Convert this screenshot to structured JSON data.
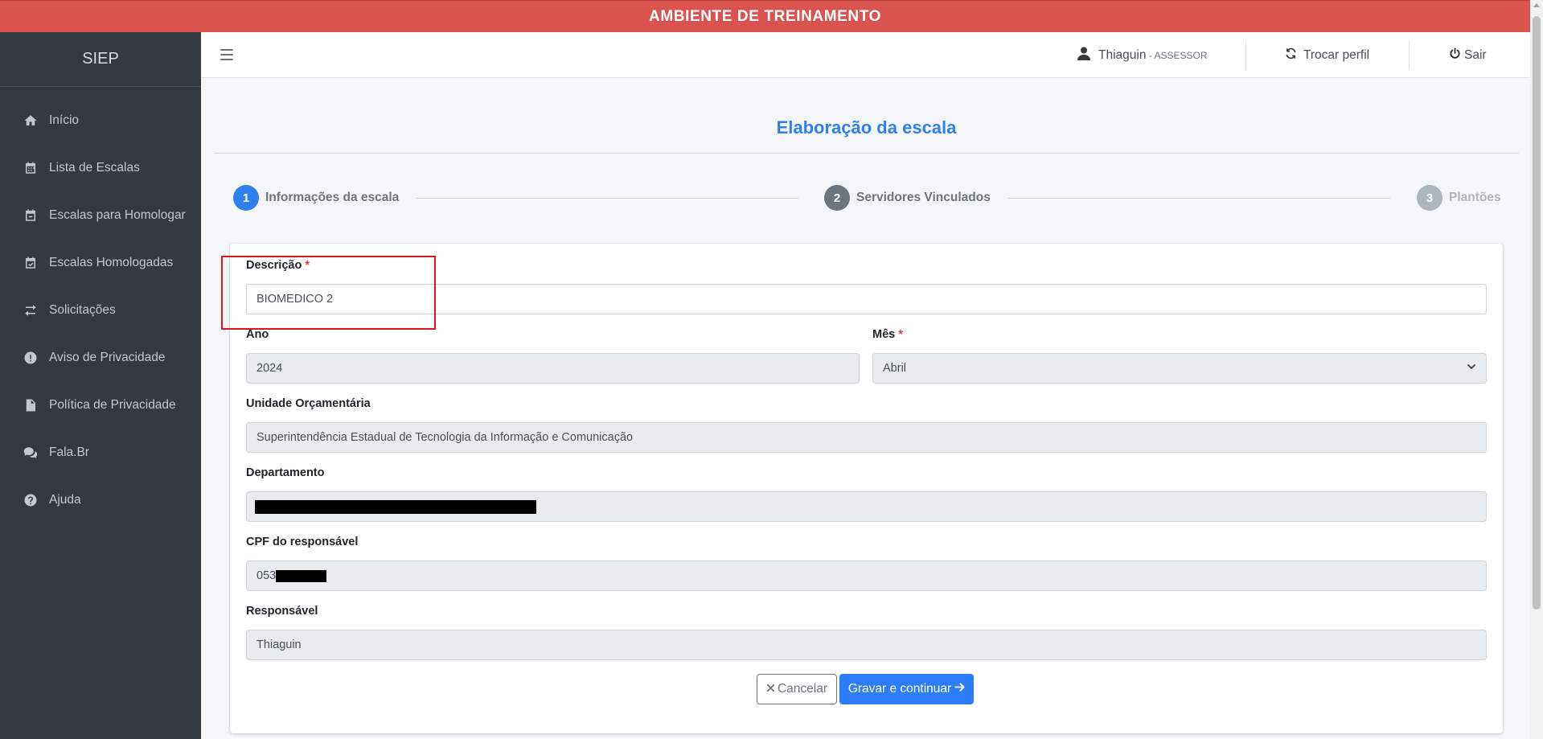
{
  "banner": {
    "text": "AMBIENTE DE TREINAMENTO"
  },
  "brand": "SIEP",
  "sidebar": {
    "items": [
      {
        "label": "Início",
        "icon": "home-icon"
      },
      {
        "label": "Lista de Escalas",
        "icon": "calendar-icon"
      },
      {
        "label": "Escalas para Homologar",
        "icon": "calendar-minus-icon"
      },
      {
        "label": "Escalas Homologadas",
        "icon": "calendar-check-icon"
      },
      {
        "label": "Solicitações",
        "icon": "exchange-icon"
      },
      {
        "label": "Aviso de Privacidade",
        "icon": "exclamation-circle-icon"
      },
      {
        "label": "Política de Privacidade",
        "icon": "file-icon"
      },
      {
        "label": "Fala.Br",
        "icon": "comments-icon"
      },
      {
        "label": "Ajuda",
        "icon": "question-circle-icon"
      }
    ]
  },
  "navbar": {
    "user_name": "Thiaguin",
    "user_sep": " - ",
    "user_role": "ASSESSOR",
    "switch_profile": "Trocar perfil",
    "logout": "Sair"
  },
  "page": {
    "title": "Elaboração da escala"
  },
  "stepper": {
    "steps": [
      {
        "number": "1",
        "label": "Informações da escala",
        "state": "active"
      },
      {
        "number": "2",
        "label": "Servidores Vinculados",
        "state": "pending"
      },
      {
        "number": "3",
        "label": "Plantões",
        "state": "disabled"
      }
    ]
  },
  "form": {
    "descricao": {
      "label": "Descrição",
      "required_mark": "*",
      "value": "BIOMEDICO 2"
    },
    "ano": {
      "label": "Ano",
      "value": "2024"
    },
    "mes": {
      "label": "Mês",
      "required_mark": "*",
      "value": "Abril"
    },
    "unidade": {
      "label": "Unidade Orçamentária",
      "value": "Superintendência Estadual de Tecnologia da Informação e Comunicação"
    },
    "departamento": {
      "label": "Departamento",
      "value": ""
    },
    "cpf": {
      "label": "CPF do responsável",
      "value_visible_prefix": "053"
    },
    "responsavel": {
      "label": "Responsável",
      "value": "Thiaguin"
    }
  },
  "actions": {
    "cancel": "Cancelar",
    "save": "Gravar e continuar"
  },
  "colors": {
    "banner": "#d9534f",
    "sidebar": "#343a40",
    "accent": "#2f80ed",
    "primary_button": "#2f7df6",
    "step_active": "#2f80ed",
    "step_pending": "#6c757d",
    "step_disabled": "#adb5bd",
    "highlight_box": "#e0141c"
  }
}
